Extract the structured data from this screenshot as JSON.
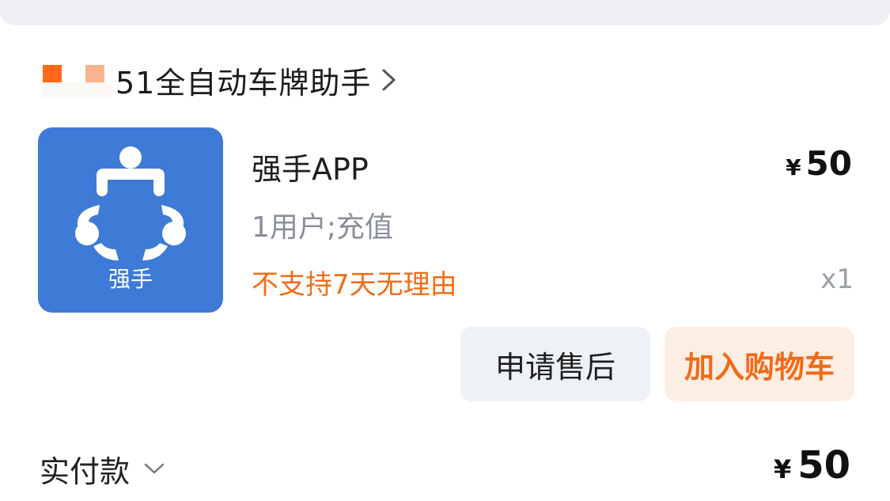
{
  "shop": {
    "name": "51全自动车牌助手"
  },
  "product": {
    "icon_label": "强手",
    "title": "强手APP",
    "currency": "¥",
    "price": "50",
    "spec": "1用户;充值",
    "note": "不支持7天无理由",
    "quantity": "x1"
  },
  "actions": {
    "after_sale": "申请售后",
    "add_to_cart": "加入购物车"
  },
  "payment": {
    "label": "实付款",
    "currency": "¥",
    "amount": "50"
  },
  "colors": {
    "accent": "#f26a17",
    "icon_bg": "#3d7bd6",
    "cart_bg": "#fdeee3",
    "after_sale_bg": "#eef2f7"
  }
}
